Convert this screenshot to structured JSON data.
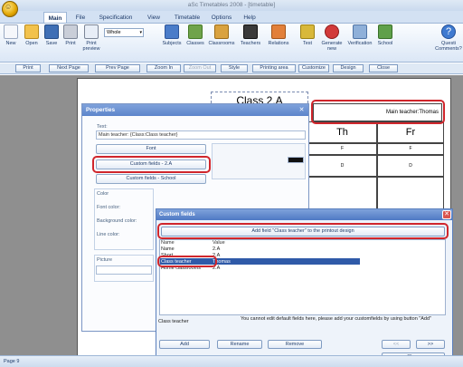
{
  "window": {
    "title": "aSc Timetables 2008 - [timetable]"
  },
  "menu_tabs": [
    "Main",
    "File",
    "Specification",
    "View",
    "Timetable",
    "Options",
    "Help"
  ],
  "ribbon": {
    "new": "New",
    "open": "Open",
    "save": "Save",
    "print": "Print",
    "print_preview": "Print preview",
    "view_select": "Whole",
    "subjects": "Subjects",
    "classes": "Classes",
    "classrooms": "Classrooms",
    "teachers": "Teachers",
    "relations": "Relations",
    "test": "Test",
    "generate_new": "Generate new",
    "verification": "Verification",
    "school": "School",
    "questions": "Questi Comments?"
  },
  "toolbar": {
    "print": "Print",
    "next_page": "Next Page",
    "prev_page": "Prev Page",
    "zoom_in": "Zoom In",
    "zoom_out": "Zoom Out",
    "style": "Style",
    "printing_area": "Printing area",
    "customize": "Customize",
    "design": "Design",
    "close": "Close"
  },
  "timetable": {
    "class_title": "Class 2.A",
    "main_teacher_cell": "Main teacher:Thomas",
    "days": [
      "Th",
      "Fr"
    ],
    "slots": [
      [
        "F",
        "F"
      ],
      [
        "D",
        "D"
      ]
    ]
  },
  "properties": {
    "title": "Properties",
    "text_label": "Text:",
    "text_value": "Main teacher: {Class:Class teacher}",
    "font_button": "Font",
    "custom_fields_2a_button": "Custom fields - 2.A",
    "custom_fields_school_button": "Custom fields - School",
    "color_label": "Color",
    "font_color_label": "Font color:",
    "background_color_label": "Background color:",
    "line_color_label": "Line color:",
    "picture_label": "Picture"
  },
  "custom_fields_dialog": {
    "title": "Custom fields",
    "add_field_button": "Add field \"Class teacher\" to the printout design",
    "columns": [
      "Name",
      "Value"
    ],
    "rows": [
      {
        "name": "Name",
        "value": "2.A"
      },
      {
        "name": "Short",
        "value": "2.A"
      },
      {
        "name": "Class teacher",
        "value": "Thomas"
      },
      {
        "name": "Home classrooms",
        "value": "2.A"
      }
    ],
    "selected_field": "Class teacher",
    "info_text": "You cannot edit default fields here, please add your customfields by using button \"Add\"",
    "add_button": "Add",
    "rename_button": "Rename",
    "remove_button": "Remove",
    "prev_button": "<<",
    "next_button": ">>",
    "close_button": "Close"
  },
  "status": {
    "page": "Page 9"
  },
  "colors": {
    "highlight": "#d0262c",
    "selection": "#2f5aa8",
    "title_gradient": "#5d85cb"
  }
}
